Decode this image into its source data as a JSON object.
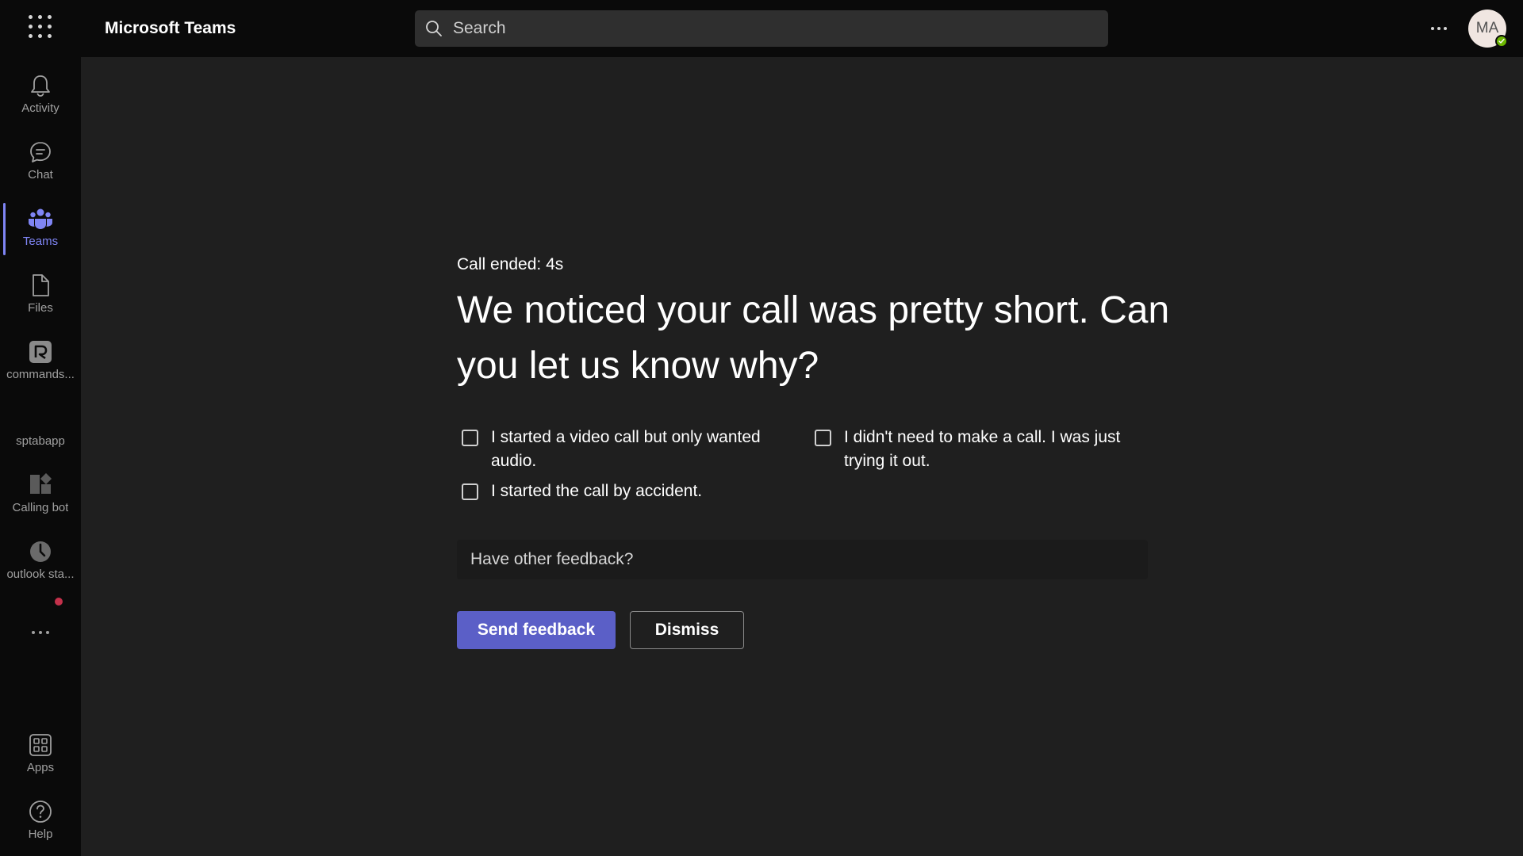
{
  "app": {
    "title": "Microsoft Teams"
  },
  "search": {
    "placeholder": "Search"
  },
  "user": {
    "initials": "MA",
    "presence": "available"
  },
  "rail": {
    "items": [
      {
        "label": "Activity",
        "icon": "bell-icon"
      },
      {
        "label": "Chat",
        "icon": "chat-icon"
      },
      {
        "label": "Teams",
        "icon": "teams-icon",
        "active": true
      },
      {
        "label": "Files",
        "icon": "file-icon"
      },
      {
        "label": "commands...",
        "icon": "commands-app-icon"
      },
      {
        "label": "sptabapp",
        "icon": "sptabapp-icon"
      },
      {
        "label": "Calling bot",
        "icon": "calling-bot-icon"
      },
      {
        "label": "outlook sta...",
        "icon": "outlook-app-icon"
      }
    ],
    "bottom": [
      {
        "label": "Apps",
        "icon": "apps-icon"
      },
      {
        "label": "Help",
        "icon": "help-icon"
      }
    ]
  },
  "feedback": {
    "call_ended": "Call ended: 4s",
    "headline": "We noticed your call was pretty short. Can you let us know why?",
    "options": [
      {
        "label": "I started a video call but only wanted audio.",
        "checked": false
      },
      {
        "label": "I didn't need to make a call. I was just trying it out.",
        "checked": false
      },
      {
        "label": "I started the call by accident.",
        "checked": false
      }
    ],
    "other_placeholder": "Have other feedback?",
    "send_label": "Send feedback",
    "dismiss_label": "Dismiss"
  },
  "colors": {
    "accent": "#5b5fc7",
    "active_rail": "#7f85f5",
    "background": "#1f1f1f",
    "chrome": "#0a0a0a",
    "presence_available": "#6bb700",
    "notification_dot": "#c4314b"
  }
}
